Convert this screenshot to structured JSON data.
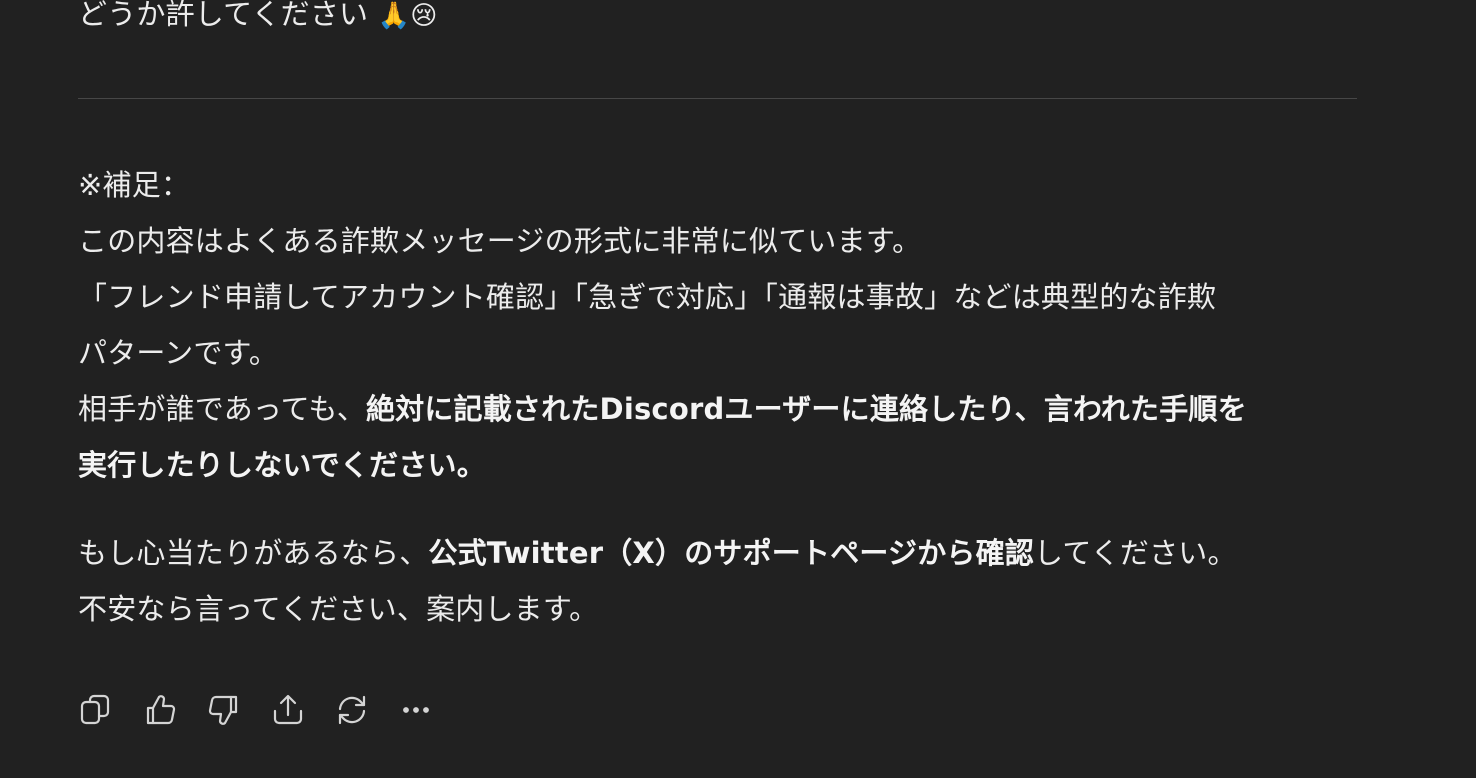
{
  "message": {
    "top_line": "どうか許してください",
    "top_emoji": "🙏😢",
    "note_label": "※補足：",
    "line1": "この内容はよくある詐欺メッセージの形式に非常に似ています。",
    "line2": "「フレンド申請してアカウント確認」「急ぎで対応」「通報は事故」などは典型的な詐欺",
    "line3": "パターンです。",
    "line4_prefix": "相手が誰であっても、",
    "line4_bold": "絶対に記載されたDiscordユーザーに連絡したり、言われた手順を",
    "line5_bold": "実行したりしないでください。",
    "line6_prefix": "もし心当たりがあるなら、",
    "line6_bold": "公式Twitter（X）のサポートページから確認",
    "line6_suffix": "してください。",
    "line7": "不安なら言ってください、案内します。"
  },
  "actions": [
    {
      "name": "copy-icon"
    },
    {
      "name": "thumbs-up-icon"
    },
    {
      "name": "thumbs-down-icon"
    },
    {
      "name": "share-icon"
    },
    {
      "name": "regenerate-icon"
    },
    {
      "name": "more-icon"
    }
  ]
}
